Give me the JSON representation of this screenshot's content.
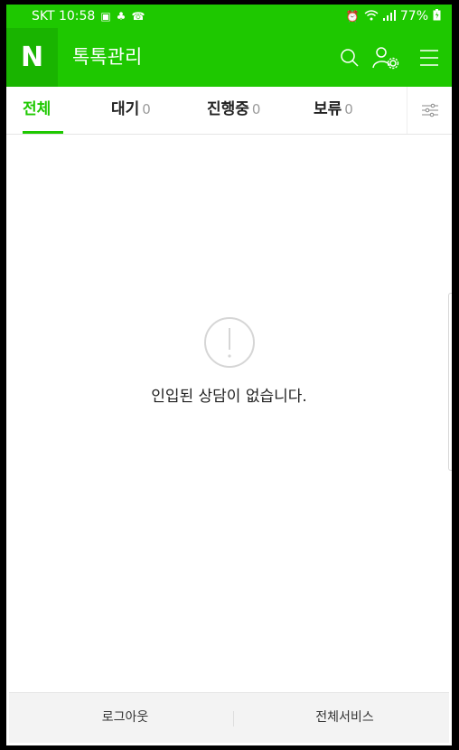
{
  "status_bar": {
    "carrier_time": "SKT 10:58",
    "battery": "77%"
  },
  "app_bar": {
    "logo_letter": "N",
    "title": "톡톡관리"
  },
  "tabs": [
    {
      "label": "전체",
      "count": ""
    },
    {
      "label": "대기",
      "count": "0"
    },
    {
      "label": "진행중",
      "count": "0"
    },
    {
      "label": "보류",
      "count": "0"
    }
  ],
  "empty_state": {
    "message": "인입된 상담이 없습니다."
  },
  "footer": {
    "logout": "로그아웃",
    "all_services": "전체서비스"
  },
  "colors": {
    "brand": "#1EC800",
    "logo_bg": "#19B400"
  },
  "icons": {
    "search": "search-icon",
    "account_settings": "user-settings-icon",
    "menu": "hamburger-menu-icon",
    "filter": "filter-sliders-icon",
    "empty": "exclamation-circle-icon"
  }
}
